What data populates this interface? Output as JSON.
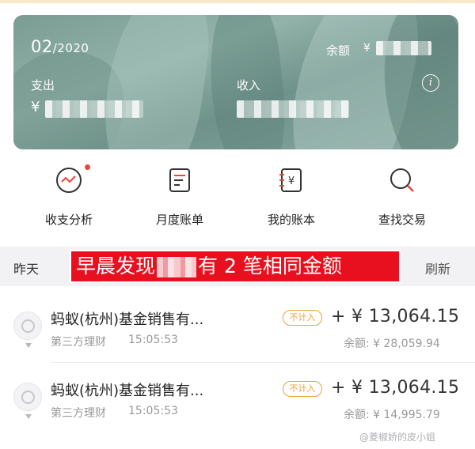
{
  "card": {
    "month": "02",
    "year": "/2020",
    "balance_label": "余额",
    "currency": "¥",
    "expense_label": "支出",
    "expense_currency": "¥",
    "income_label": "收入",
    "info_glyph": "i",
    "background_colors": [
      "#7a9c93",
      "#93b3aa",
      "#6f928a"
    ]
  },
  "actions": [
    {
      "label": "收支分析",
      "icon": "trend-chart-icon",
      "has_badge": true
    },
    {
      "label": "月度账单",
      "icon": "bill-document-icon",
      "has_badge": false
    },
    {
      "label": "我的账本",
      "icon": "ledger-book-icon",
      "has_badge": false
    },
    {
      "label": "查找交易",
      "icon": "search-icon",
      "has_badge": false
    }
  ],
  "day_header": {
    "day": "昨天",
    "refresh": "刷新"
  },
  "banner": {
    "before": "早晨发现",
    "after": "有 2 笔相同金额",
    "color": "#e8101e"
  },
  "transactions": [
    {
      "name": "蚂蚁(杭州)基金销售有...",
      "category": "第三方理财",
      "time": "15:05:53",
      "badge": "不计入",
      "amount": "+ ¥  13,064.15",
      "balance": "余额: ¥ 28,059.94"
    },
    {
      "name": "蚂蚁(杭州)基金销售有...",
      "category": "第三方理财",
      "time": "15:05:53",
      "badge": "不计入",
      "amount": "+ ¥  13,064.15",
      "balance": "余额: ¥ 14,995.79"
    }
  ],
  "watermark": "@菱椒娇的皮小姐",
  "colors": {
    "accent_red": "#e8453c",
    "badge_orange": "#e9a33a"
  }
}
